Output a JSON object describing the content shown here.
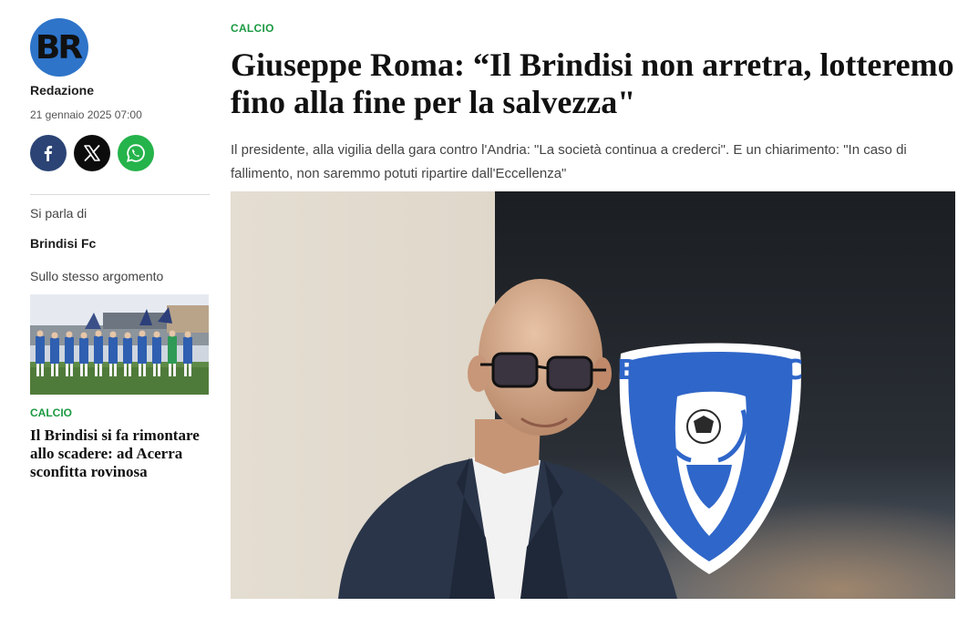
{
  "sidebar": {
    "avatar": {
      "initials_1": "B",
      "initials_2": "R"
    },
    "author": "Redazione",
    "date": "21 gennaio 2025 07:00",
    "social": [
      {
        "name": "facebook-icon",
        "glyph": "f"
      },
      {
        "name": "x-icon",
        "glyph": "X"
      },
      {
        "name": "whatsapp-icon"
      }
    ],
    "si_parla_di_label": "Si parla di",
    "tag": "Brindisi Fc",
    "same_topic_label": "Sullo stesso argomento",
    "related": {
      "category": "CALCIO",
      "title": "Il Brindisi si fa rimontare allo scadere: ad Acerra sconfitta rovinosa"
    }
  },
  "article": {
    "category": "CALCIO",
    "headline": "Giuseppe Roma: “Il Brindisi non arretra, lotteremo fino alla fine per la salvezza\"",
    "subtitle": "Il presidente, alla vigilia della gara contro l'Andria: \"La società continua a crederci\". E un chiarimento: \"In caso di fallimento, non saremmo potuti ripartire dall'Eccellenza\"",
    "hero_crest_text": "BRINDISI FC"
  },
  "colors": {
    "accent_green": "#1c9a43",
    "avatar_blue": "#2e74c9",
    "facebook": "#2b4475",
    "x": "#0c0c0c",
    "whatsapp": "#25b34b"
  }
}
